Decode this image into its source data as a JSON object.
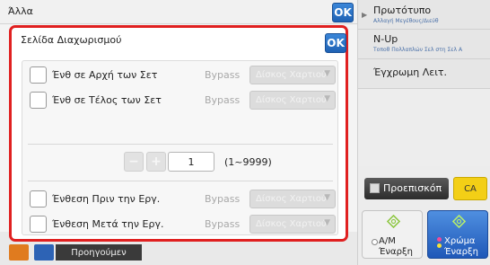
{
  "window": {
    "title": "Άλλα",
    "ok_label": "OK",
    "prev_label": "Προηγούμεν"
  },
  "dialog": {
    "title": "Σελίδα Διαχωρισμού",
    "ok_label": "OK",
    "rows": [
      {
        "label": "Ένθ σε Αρχή των Σετ",
        "bypass": "Bypass",
        "select": "Δίσκος Χαρτιού"
      },
      {
        "label": "Ένθ σε Τέλος των Σετ",
        "bypass": "Bypass",
        "select": "Δίσκος Χαρτιού"
      },
      {
        "label": "Ένθεση Πριν την Εργ.",
        "bypass": "Bypass",
        "select": "Δίσκος Χαρτιού"
      },
      {
        "label": "Ένθεση Μετά την Εργ.",
        "bypass": "Bypass",
        "select": "Δίσκος Χαρτιού"
      }
    ],
    "stepper": {
      "minus": "−",
      "plus": "+",
      "value": "1",
      "range": "(1~9999)"
    }
  },
  "right_panel": {
    "items": [
      {
        "main": "Πρωτότυπο",
        "sub": "Αλλαγή Μεγέθους/Διεύθ"
      },
      {
        "main": "N-Up",
        "sub": "Τοποθ Πολλαπλών Σελ στη Σελ Α"
      },
      {
        "main": "Έγχρωμη Λειτ.",
        "sub": ""
      }
    ],
    "preview_label": "Προεπισκόπ",
    "ca_label": "CA",
    "start_bw": {
      "line1": "A/M",
      "line2": "Έναρξη"
    },
    "start_color": {
      "line1": "Χρώμα",
      "line2": "Έναρξη"
    }
  },
  "colors": {
    "accent_blue": "#1f62b4",
    "highlight_red": "#e02020",
    "ca_yellow": "#f3cf16"
  }
}
